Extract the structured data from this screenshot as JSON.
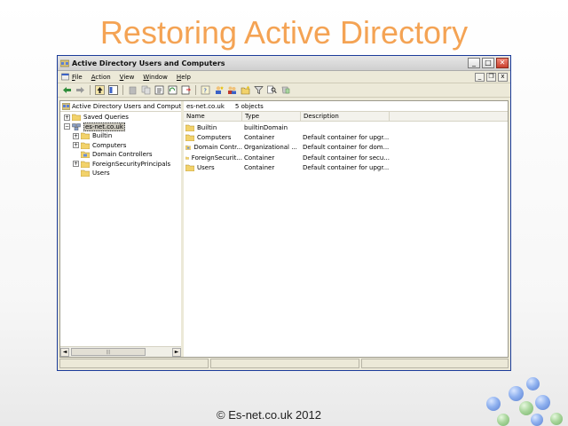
{
  "slide": {
    "title": "Restoring Active Directory",
    "footer": "© Es-net.co.uk 2012"
  },
  "window": {
    "title": "Active Directory Users and Computers",
    "buttons": {
      "minimize": "_",
      "maximize": "□",
      "close": "✕"
    }
  },
  "menubar": {
    "items": [
      {
        "label": "File",
        "accel": "F"
      },
      {
        "label": "Action",
        "accel": "A"
      },
      {
        "label": "View",
        "accel": "V"
      },
      {
        "label": "Window",
        "accel": "W"
      },
      {
        "label": "Help",
        "accel": "H"
      }
    ],
    "mdi": {
      "minimize": "_",
      "restore": "❐",
      "close": "x"
    }
  },
  "toolbar": {
    "icons": [
      "back-icon",
      "forward-icon",
      "up-icon",
      "show-hide-tree-icon",
      "cut-icon",
      "copy-icon",
      "properties-icon",
      "refresh-icon",
      "export-list-icon",
      "help-icon",
      "new-user-icon",
      "new-group-icon",
      "new-ou-icon",
      "filter-icon",
      "find-icon",
      "add-to-group-icon"
    ]
  },
  "tree": {
    "header": "Active Directory Users and Computers",
    "nodes": [
      {
        "label": "Saved Queries",
        "level": 1,
        "expander": "+",
        "icon": "folder-icon"
      },
      {
        "label": "es-net.co.uk",
        "level": 1,
        "expander": "−",
        "icon": "domain-icon",
        "selected": true
      },
      {
        "label": "Builtin",
        "level": 2,
        "expander": "+",
        "icon": "folder-icon"
      },
      {
        "label": "Computers",
        "level": 2,
        "expander": "+",
        "icon": "folder-icon"
      },
      {
        "label": "Domain Controllers",
        "level": 2,
        "expander": "",
        "icon": "ou-icon"
      },
      {
        "label": "ForeignSecurityPrincipals",
        "level": 2,
        "expander": "+",
        "icon": "folder-icon"
      },
      {
        "label": "Users",
        "level": 2,
        "expander": "",
        "icon": "folder-icon"
      }
    ]
  },
  "list": {
    "location": "es-net.co.uk",
    "count": "5 objects",
    "columns": {
      "name": "Name",
      "type": "Type",
      "description": "Description"
    },
    "rows": [
      {
        "name": "Builtin",
        "type": "builtinDomain",
        "description": "",
        "icon": "folder-icon"
      },
      {
        "name": "Computers",
        "type": "Container",
        "description": "Default container for upgr...",
        "icon": "folder-icon"
      },
      {
        "name": "Domain Contr...",
        "type": "Organizational ...",
        "description": "Default container for dom...",
        "icon": "ou-icon"
      },
      {
        "name": "ForeignSecurit...",
        "type": "Container",
        "description": "Default container for secu...",
        "icon": "folder-icon"
      },
      {
        "name": "Users",
        "type": "Container",
        "description": "Default container for upgr...",
        "icon": "folder-icon"
      }
    ]
  },
  "scroll": {
    "left": "◄",
    "right": "►",
    "thumb": "|||"
  }
}
